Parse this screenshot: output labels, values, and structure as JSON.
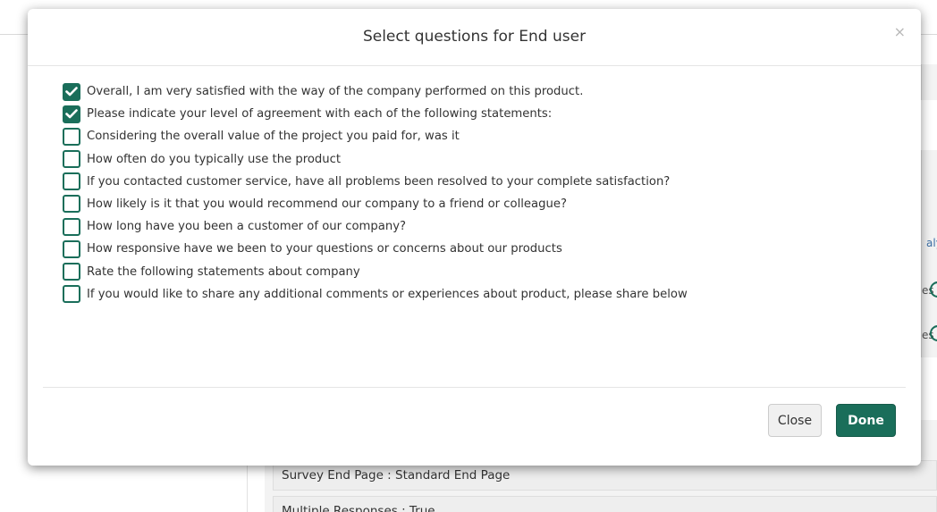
{
  "dialog": {
    "title": "Select questions for End user",
    "close_icon": "×",
    "questions": [
      {
        "label": "Overall, I am very satisfied with the way of the company performed on this product.",
        "checked": true
      },
      {
        "label": "Please indicate your level of agreement with each of the following statements:",
        "checked": true
      },
      {
        "label": "Considering the overall value of the project you paid for, was it",
        "checked": false
      },
      {
        "label": "How often do you typically use the product",
        "checked": false
      },
      {
        "label": "If you contacted customer service, have all problems been resolved to your complete satisfaction?",
        "checked": false
      },
      {
        "label": "How likely is it that you would recommend our company to a friend or colleague?",
        "checked": false
      },
      {
        "label": "How long have you been a customer of our company?",
        "checked": false
      },
      {
        "label": "How responsive have we been to your questions or concerns about our products",
        "checked": false
      },
      {
        "label": "Rate the following statements about company",
        "checked": false
      },
      {
        "label": "If you would like to share any additional comments or experiences about product, please share below",
        "checked": false
      }
    ],
    "close_label": "Close",
    "done_label": "Done"
  },
  "background": {
    "end_page_row": "Survey End Page : Standard End Page",
    "multiple_responses_row": "Multiple Responses : True",
    "right_fragments": [
      "aly",
      "es",
      "es"
    ]
  },
  "colors": {
    "accent": "#1a6e5a",
    "overlay": "#ffffff"
  }
}
